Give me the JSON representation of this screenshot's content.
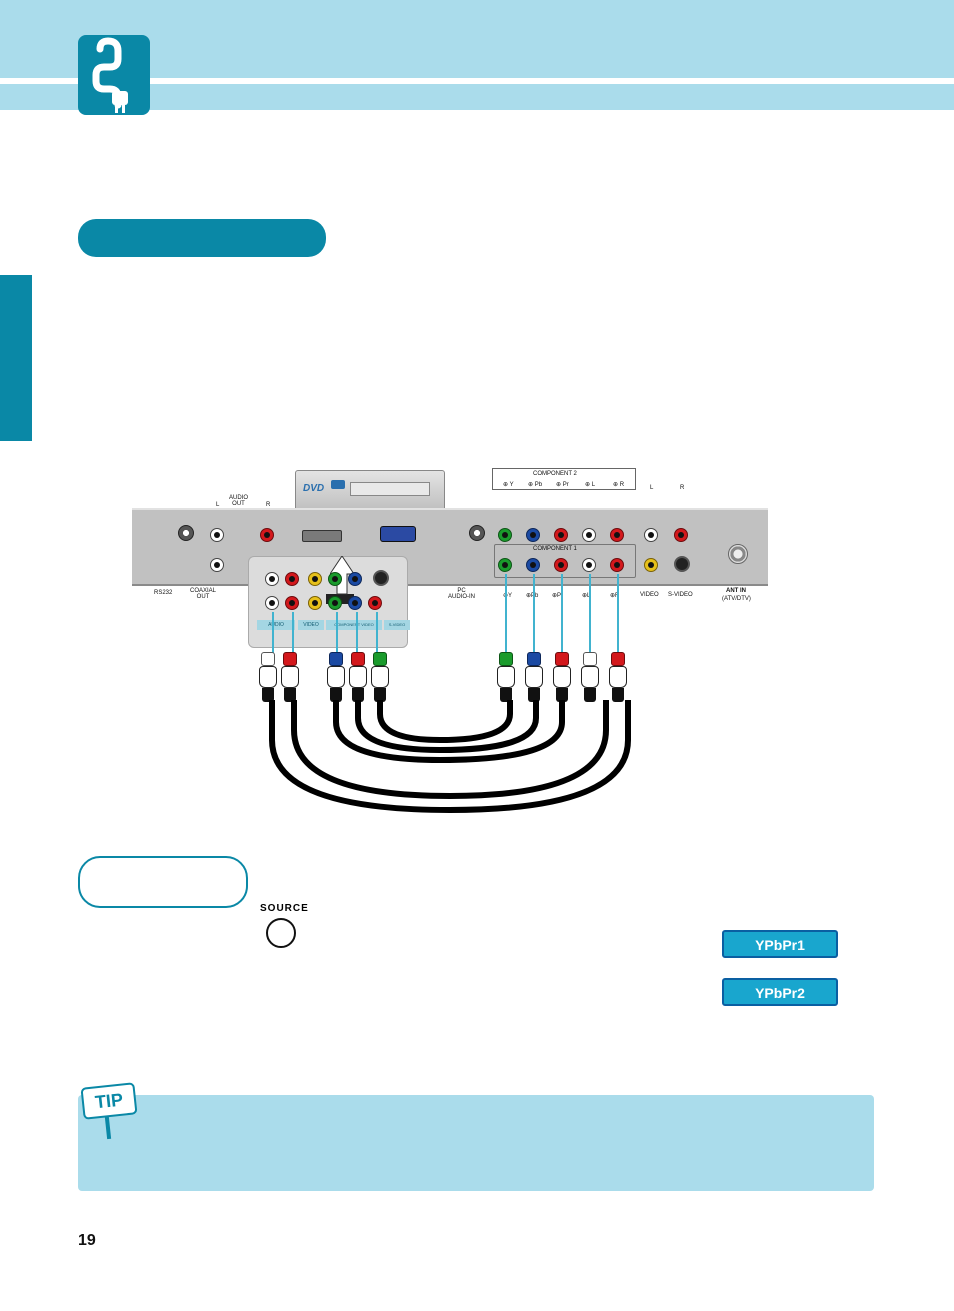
{
  "page_number": "19",
  "source_label": "SOURCE",
  "chips": {
    "ypbpr1": "YPbPr1",
    "ypbpr2": "YPbPr2"
  },
  "tip_badge": "TIP",
  "device": {
    "dvd_text": "DVD"
  },
  "panel": {
    "audio_out": "AUDIO\nOUT",
    "L": "L",
    "R": "R",
    "rs232": "RS232",
    "coaxial_out": "COAXIAL\nOUT",
    "pc_audio_in": "PC\nAUDIO-IN",
    "component1": "COMPONENT 1",
    "component2": "COMPONENT 2",
    "y": "Y",
    "pb": "Pb",
    "pr": "Pr",
    "video": "VIDEO",
    "s_video": "S-VIDEO",
    "ant_in": "ANT IN",
    "ant_in_sub": "(ATV/DTV)"
  },
  "ext_box": {
    "audio": "AUDIO",
    "video": "VIDEO",
    "component_video": "COMPONENT VIDEO",
    "s_video": "S-VIDEO"
  }
}
